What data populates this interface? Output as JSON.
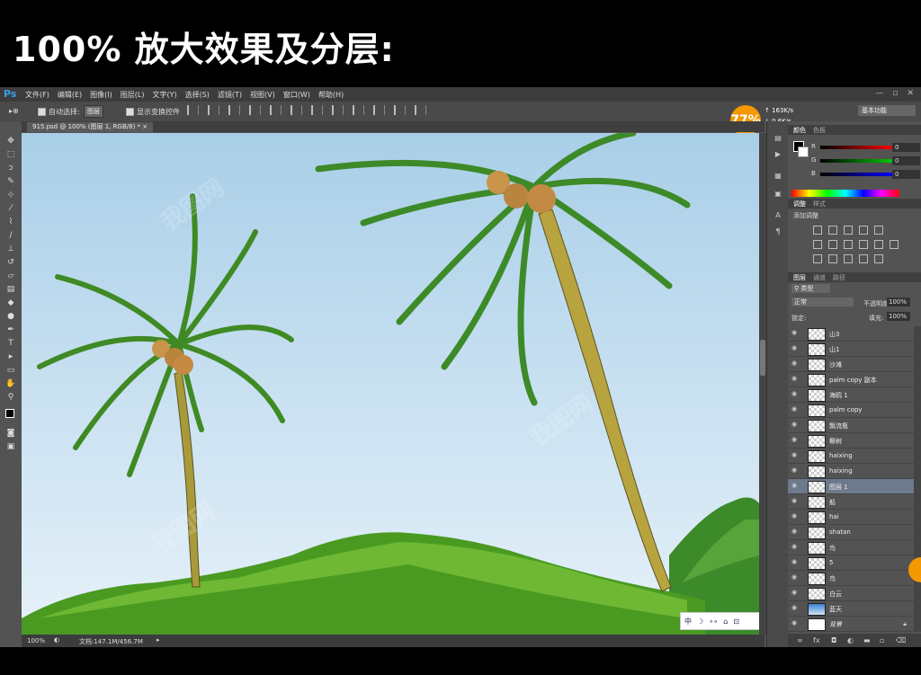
{
  "banner": {
    "title": "100% 放大效果及分层:"
  },
  "app": {
    "logo": "Ps",
    "menu": [
      "文件(F)",
      "编辑(E)",
      "图像(I)",
      "图层(L)",
      "文字(Y)",
      "选择(S)",
      "滤镜(T)",
      "视图(V)",
      "窗口(W)",
      "帮助(H)"
    ],
    "window_controls": [
      "—",
      "▫",
      "✕"
    ]
  },
  "options": {
    "auto_select_label": "自动选择:",
    "auto_select_value": "图层",
    "show_transform_label": "显示变换控件",
    "workspace": "基本功能"
  },
  "net_meter": {
    "percent": "77%",
    "up": "163K/s",
    "down": "0.6K/s"
  },
  "document": {
    "tab": "915.psd @ 100% (图层 1, RGB/8) *"
  },
  "status": {
    "zoom": "100%",
    "doc_size": "文档:147.1M/456.7M"
  },
  "ime": {
    "items": [
      "中",
      "☽",
      "∘∘",
      "⌂",
      "⊡"
    ]
  },
  "color_panel": {
    "tabs": [
      "颜色",
      "色板"
    ],
    "channels": [
      {
        "label": "R",
        "value": "0",
        "color": "#e02020"
      },
      {
        "label": "G",
        "value": "0",
        "color": "#20c020"
      },
      {
        "label": "B",
        "value": "0",
        "color": "#2040e0"
      }
    ]
  },
  "adjust_panel": {
    "tabs": [
      "调整",
      "样式"
    ],
    "add_label": "添加调整"
  },
  "layers_panel": {
    "tabs": [
      "图层",
      "通道",
      "路径"
    ],
    "kind_filter": "类型",
    "blend_mode": "正常",
    "opacity_label": "不透明度:",
    "opacity_value": "100%",
    "lock_label": "锁定:",
    "fill_label": "填充:",
    "fill_value": "100%",
    "layers": [
      {
        "name": "山3",
        "active": false
      },
      {
        "name": "山1",
        "active": false
      },
      {
        "name": "沙滩",
        "active": false
      },
      {
        "name": "palm copy 副本",
        "active": false
      },
      {
        "name": "海鸥 1",
        "active": false
      },
      {
        "name": "palm copy",
        "active": false
      },
      {
        "name": "飘流瓶",
        "active": false
      },
      {
        "name": "椰树",
        "active": false
      },
      {
        "name": "haixing",
        "active": false
      },
      {
        "name": "haixing",
        "active": false
      },
      {
        "name": "图层 1",
        "active": true
      },
      {
        "name": "船",
        "active": false
      },
      {
        "name": "hai",
        "active": false
      },
      {
        "name": "shatan",
        "active": false
      },
      {
        "name": "鸟",
        "active": false
      },
      {
        "name": "5",
        "active": false
      },
      {
        "name": "鸟",
        "active": false
      },
      {
        "name": "白云",
        "active": false
      },
      {
        "name": "蓝天",
        "active": false
      },
      {
        "name": "背景",
        "active": false
      }
    ]
  },
  "colors": {
    "accent": "#f39800",
    "app_bg": "#535353",
    "sky_top": "#a9cfe8",
    "grass": "#3f8a1e"
  }
}
